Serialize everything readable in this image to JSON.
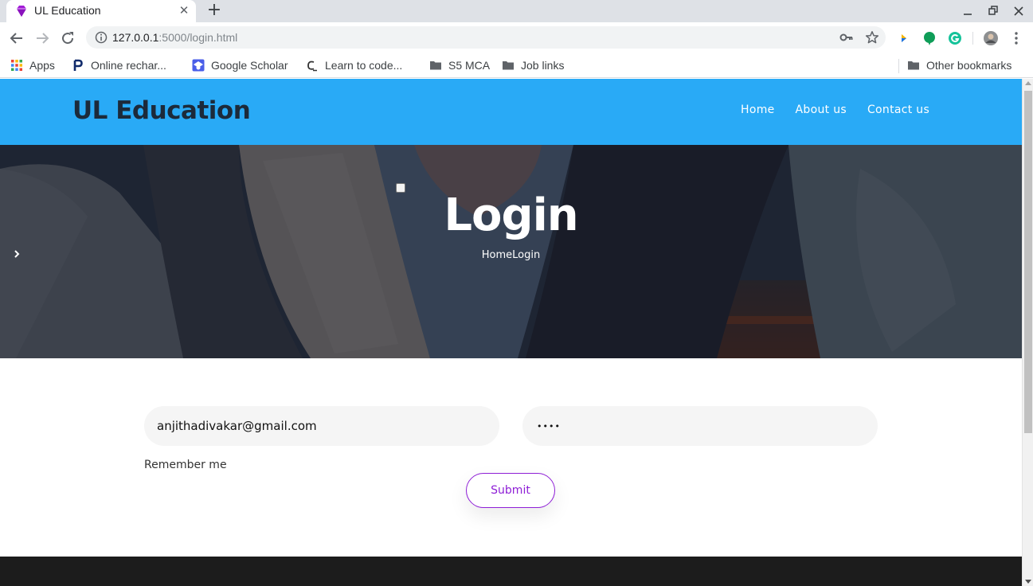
{
  "browser": {
    "tab": {
      "title": "UL Education",
      "close_glyph": "✕",
      "favicon": "gem-icon"
    },
    "new_tab_glyph": "+",
    "omnibox": {
      "host": "127.0.0.1",
      "rest": ":5000/login.html"
    },
    "bookmarks": [
      {
        "label": "Apps",
        "icon": "apps-grid-icon"
      },
      {
        "label": "Online rechar...",
        "icon": "paytm-icon"
      },
      {
        "label": "Google Scholar",
        "icon": "scholar-icon"
      },
      {
        "label": "Learn to code...",
        "icon": "codecademy-icon"
      },
      {
        "label": "S5 MCA",
        "icon": "folder-icon"
      },
      {
        "label": "Job links",
        "icon": "folder-icon"
      }
    ],
    "other_bookmarks": "Other bookmarks"
  },
  "site": {
    "brand": "UL Education",
    "nav": [
      "Home",
      "About us",
      "Contact us"
    ],
    "accent_color": "#29aaf6",
    "button_color": "#8e1ed6"
  },
  "hero": {
    "title": "Login",
    "breadcrumb": {
      "home": "Home",
      "current": "Login"
    }
  },
  "form": {
    "email_value": "anjithadivakar@gmail.com",
    "password_mask": "••••",
    "remember_label": "Remember me",
    "remember_checked": false,
    "submit_label": "Submit"
  }
}
